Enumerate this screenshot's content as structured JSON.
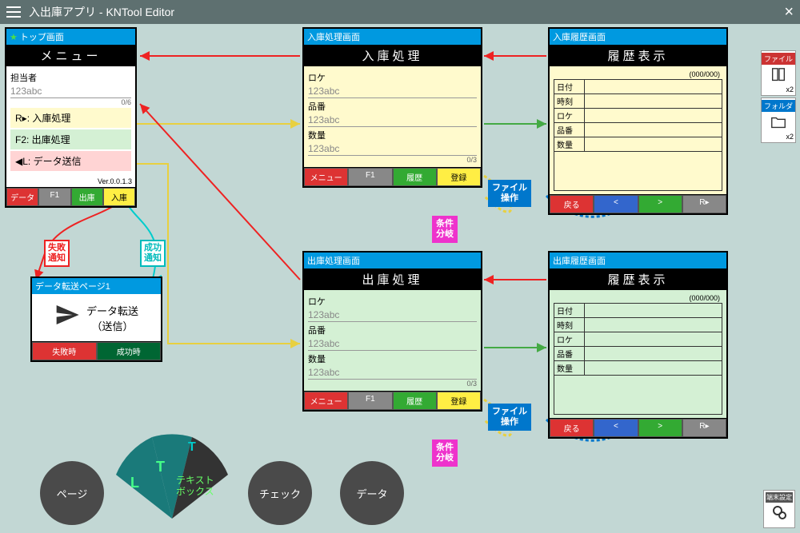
{
  "titlebar": {
    "text": "入出庫アプリ - KNTool Editor"
  },
  "nodes": {
    "topScreen": {
      "head": "トップ画面",
      "title": "メニュー",
      "manager": "担当者",
      "input": "123abc",
      "counter": "0/6",
      "items": [
        "R▸: 入庫処理",
        "F2: 出庫処理",
        "◀L: データ送信"
      ],
      "ver": "Ver.0.0.1.3",
      "fkeys": [
        "データ",
        "F1",
        "出庫",
        "入庫"
      ]
    },
    "transfer": {
      "head": "データ転送ページ1",
      "label": "データ転送\n（送信）",
      "fkeys": [
        "失敗時",
        "成功時"
      ]
    },
    "inbound": {
      "head": "入庫処理画面",
      "title": "入庫処理",
      "labels": [
        "ロケ",
        "品番",
        "数量"
      ],
      "input": "123abc",
      "counter": "0/3",
      "fkeys": [
        "メニュー",
        "F1",
        "履歴",
        "登録"
      ]
    },
    "outbound": {
      "head": "出庫処理画面",
      "title": "出庫処理",
      "labels": [
        "ロケ",
        "品番",
        "数量"
      ],
      "input": "123abc",
      "counter": "0/3",
      "fkeys": [
        "メニュー",
        "F1",
        "履歴",
        "登録"
      ]
    },
    "inHistory": {
      "head": "入庫履歴画面",
      "title": "履歴表示",
      "page": "(000/000)",
      "rows": [
        "日付",
        "時刻",
        "ロケ",
        "品番",
        "数量"
      ],
      "fkeys": [
        "戻る",
        "<",
        ">",
        "R▸"
      ]
    },
    "outHistory": {
      "head": "出庫履歴画面",
      "title": "履歴表示",
      "page": "(000/000)",
      "rows": [
        "日付",
        "時刻",
        "ロケ",
        "品番",
        "数量"
      ],
      "fkeys": [
        "戻る",
        "<",
        ">",
        "R▸"
      ]
    }
  },
  "badges": {
    "fail": "失敗\n通知",
    "success": "成功\n通知",
    "fileOp": "ファイル\n操作",
    "branch": "条件\n分岐"
  },
  "sidePanel": {
    "file": "ファイル",
    "folder": "フォルダ",
    "x2": "x2"
  },
  "gear": {
    "label": "端末設定"
  },
  "wheel": {
    "page": "ページ",
    "textbox_top": "テキスト",
    "textbox_bottom": "ボックス",
    "check": "チェック",
    "data": "データ",
    "T": "T",
    "L": "L"
  }
}
